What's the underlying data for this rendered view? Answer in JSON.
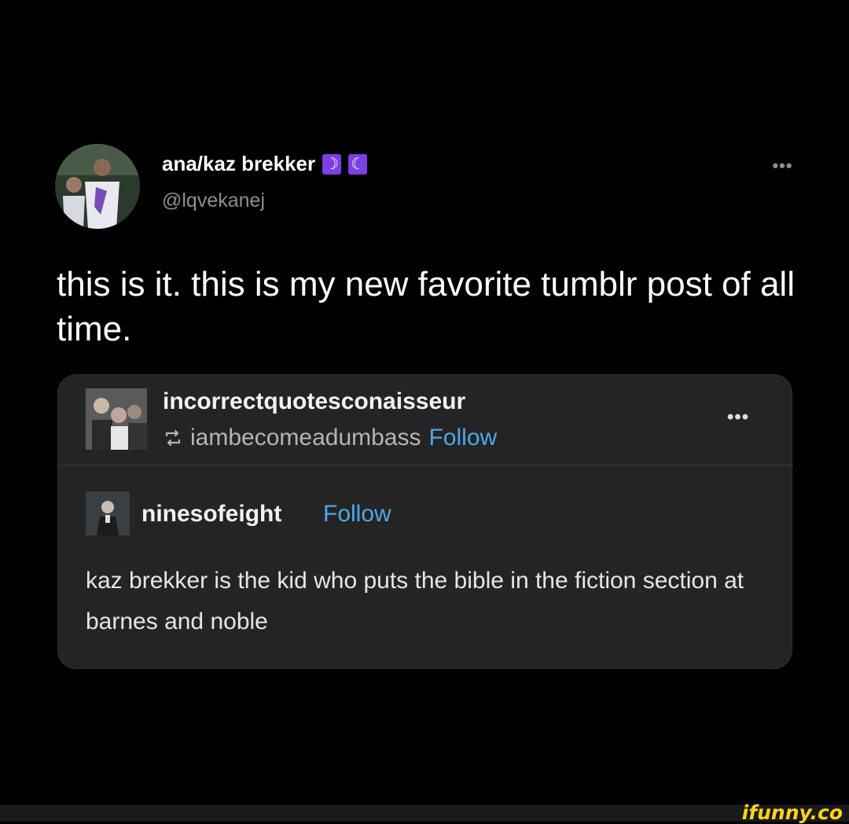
{
  "author": {
    "display_name": "ana/kaz brekker",
    "badges": [
      "☽",
      "☾"
    ],
    "handle": "@lqvekanej",
    "avatar_icon": "profile-photo",
    "more_label": "•••"
  },
  "tweet": {
    "text": "this is it. this is my new favorite tumblr post of all time."
  },
  "tumblr_post": {
    "reblogger": {
      "name": "incorrectquotesconaisseur",
      "reblogged_from": "iambecomeadumbass",
      "follow_label": "Follow",
      "more_label": "•••",
      "reblog_icon": "reblog-icon"
    },
    "original_poster": {
      "name": "ninesofeight",
      "follow_label": "Follow"
    },
    "body": "kaz brekker is the kid who puts the bible in the fiction section at barnes and noble"
  },
  "watermark": "ifunny.co",
  "colors": {
    "background": "#000000",
    "card": "#242424",
    "link": "#4ea8e8",
    "badge": "#7b3fe4",
    "watermark": "#ffd21e"
  }
}
